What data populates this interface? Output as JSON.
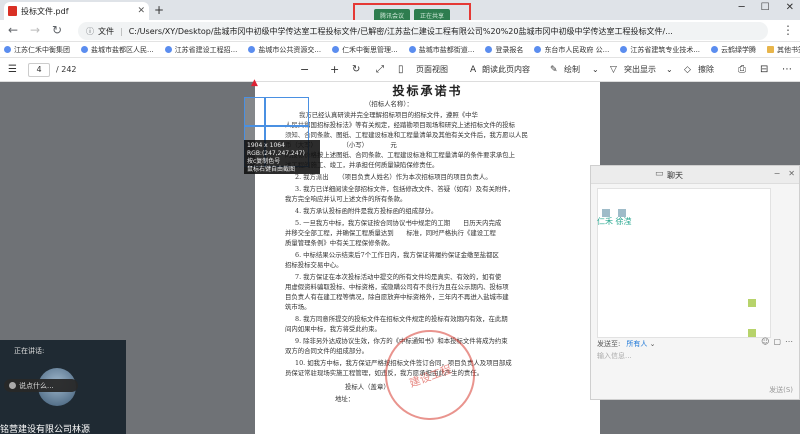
{
  "browser": {
    "tab_title": "投标文件.pdf",
    "new_tab": "+",
    "share_bar": [
      "腾讯会议",
      "正在共享"
    ],
    "window_controls": [
      "─",
      "☐",
      "✕"
    ]
  },
  "address": {
    "info_label": "文件",
    "url": "C:/Users/XY/Desktop/盐城市冈中初级中学传达室工程投标文件/已解密/江苏盐仁建设工程有限公司%20%20盐城市冈中初级中学传达室工程投标文件/..."
  },
  "bookmarks": [
    "江苏仁禾中衡集团",
    "盐城市盐都区人民...",
    "江苏省建设工程招...",
    "盐城市公共资源交...",
    "仁禾中衡思管理...",
    "盐城市盐都街道...",
    "登录报名",
    "东台市人民政府 公...",
    "江苏省建筑专业技术...",
    "云鹤绿学腾",
    "其他书签"
  ],
  "pdf_toolbar": {
    "page_current": "4",
    "page_total": "/ 242",
    "minus": "−",
    "plus": "+",
    "page_view": "页面视图",
    "read_aloud": "朗读此页内容",
    "draw": "绘制",
    "highlight": "突出显示",
    "erase": "擦除"
  },
  "document": {
    "title": "投标承诺书",
    "lines": [
      "（招标人名称）：",
      "我方已经认真研读并完全理解招标项目的招标文件，遵照《中华",
      "人民共和国招标投标法》等有关规定，经踏勘项目现场和研究上述招标文件的投标",
      "须知、合同条款、图纸、工程建设标准和工程量清单及其他有关文件后，我方愿以人民",
      "币（大写）　　　　　（小写）　　　　元",
      "的投标价格按上述图纸、合同条款、工程建设标准和工程量清单的条件要求承包上",
      "述工程的施工、竣工，并承担任何质量缺陷保修责任。",
      "2. 我方派出　　（项目负责人姓名）作为本次招标项目的项目负责人。",
      "3. 我方已详细阅读全部招标文件，包括修改文件、答疑（如有）及有关附件，",
      "我方完全响应并认可上述文件的所有条款。",
      "4. 我方承认投标函附件是我方投标函的组成部分。",
      "5. 一旦我方中标，我方保证按合同协议书中规定的工期　　日历天内完成",
      "并移交全部工程，并确保工程质量达到　　标准，同时严格执行《建设工程",
      "质量管理条例》中有关工程保修条款。",
      "6. 中标结果公示结束后7个工作日内，我方保证将履约保证金缴至盐都区",
      "招标投标交易中心。",
      "7. 我方保证在本次投标活动中提交的所有文件均是真实、有效的，如有使",
      "用虚假资料骗取投标、中标资格，或隐瞒公司有不良行为且在公示期内、投标项",
      "目负责人有在建工程等情况，除自愿放弃中标资格外，三年内不再进入盐城市建",
      "筑市场。",
      "8. 我方同意所提交的投标文件在招标文件规定的投标有效期内有效，在此期",
      "间内如果中标，我方将受此约束。",
      "9. 除非另外达成协议生效，你方的《中标通知书》和本投标文件将成为约束",
      "双方的合同文件的组成部分。",
      "10. 如我方中标，我方保证严格按招标文件签订合同，项目负责人及项目部成",
      "员保证常驻现场实施工程管理，如违反，我方愿承担由此产生的责任。",
      "投标人（盖章）",
      "地址："
    ],
    "stamp_text": "建设工程"
  },
  "screenshot_tool": {
    "size": "1904 x 1064",
    "rgb": "RGB:(247,247,247)",
    "hint1": "按c复制色号",
    "hint2": "鼠标右键自由截图"
  },
  "chat": {
    "title": "聊天",
    "user_name": "仁禾 徐滢",
    "send_to_label": "发送至:",
    "send_to_value": "所有人",
    "input_placeholder": "输入信息...",
    "send_button": "发送(S)",
    "icons": [
      "⌄",
      "☺",
      "▢",
      "⋯"
    ],
    "controls": [
      "−",
      "✕"
    ]
  },
  "speaker": {
    "label": "正在讲话:",
    "pill_text": "说点什么...",
    "name": "铭营建设有限公司林源"
  }
}
